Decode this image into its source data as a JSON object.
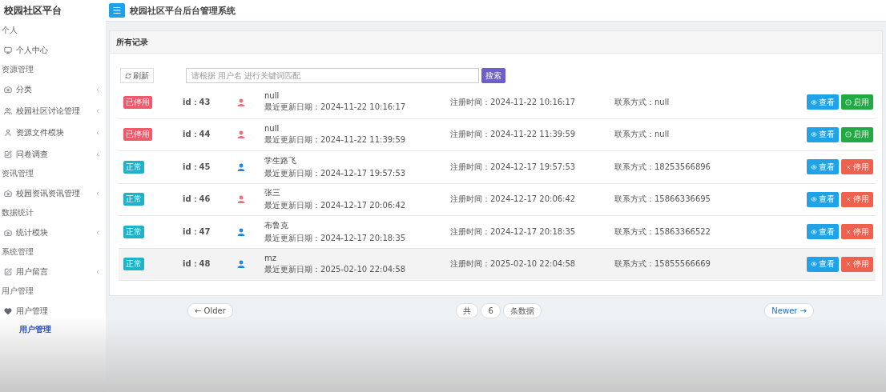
{
  "brand": "校园社区平台",
  "header": {
    "title": "校园社区平台后台管理系统"
  },
  "sidebar": [
    {
      "section": "个人",
      "items": [
        {
          "label": "个人中心",
          "caret": false
        }
      ]
    },
    {
      "section": "资源管理",
      "items": [
        {
          "label": "分类",
          "caret": true
        },
        {
          "label": "校园社区讨论管理",
          "caret": true
        },
        {
          "label": "资源文件模块",
          "caret": true
        },
        {
          "label": "问卷调查",
          "caret": true
        }
      ]
    },
    {
      "section": "资讯管理",
      "items": [
        {
          "label": "校园资讯资讯管理",
          "caret": true
        }
      ]
    },
    {
      "section": "数据统计",
      "items": [
        {
          "label": "统计模块",
          "caret": true
        }
      ]
    },
    {
      "section": "系统管理",
      "items": [
        {
          "label": "用户留言",
          "caret": true
        }
      ]
    },
    {
      "section": "用户管理",
      "items": [
        {
          "label": "用户管理",
          "caret": false,
          "children": [
            {
              "label": "用户管理",
              "selected": true
            }
          ]
        }
      ]
    }
  ],
  "panel": {
    "title": "所有记录",
    "refresh": "刷新",
    "search": {
      "placeholder": "请根据 用户名 进行关键词匹配"
    },
    "search_button": "搜索"
  },
  "rows": [
    {
      "status": {
        "label": "已停用",
        "kind": "disabled"
      },
      "id": "id：43",
      "color": "#e8707f",
      "name": "null",
      "updated": "最近更新日期：2024-11-22 10:16:17",
      "registered": "注册时间：2024-11-22 10:16:17",
      "contact": "联系方式：null",
      "view": "查看",
      "action": {
        "label": "启用",
        "kind": "enable"
      },
      "selected": false
    },
    {
      "status": {
        "label": "已停用",
        "kind": "disabled"
      },
      "id": "id：44",
      "color": "#e8707f",
      "name": "null",
      "updated": "最近更新日期：2024-11-22 11:39:59",
      "registered": "注册时间：2024-11-22 11:39:59",
      "contact": "联系方式：null",
      "view": "查看",
      "action": {
        "label": "启用",
        "kind": "enable"
      },
      "selected": false
    },
    {
      "status": {
        "label": "正常",
        "kind": "normal"
      },
      "id": "id：45",
      "color": "#1e88e5",
      "name": "学生路飞",
      "updated": "最近更新日期：2024-12-17 19:57:53",
      "registered": "注册时间：2024-12-17 19:57:53",
      "contact": "联系方式：18253566896",
      "view": "查看",
      "action": {
        "label": "停用",
        "kind": "disable"
      },
      "selected": false
    },
    {
      "status": {
        "label": "正常",
        "kind": "normal"
      },
      "id": "id：46",
      "color": "#e8707f",
      "name": "张三",
      "updated": "最近更新日期：2024-12-17 20:06:42",
      "registered": "注册时间：2024-12-17 20:06:42",
      "contact": "联系方式：15866336695",
      "view": "查看",
      "action": {
        "label": "停用",
        "kind": "disable"
      },
      "selected": false
    },
    {
      "status": {
        "label": "正常",
        "kind": "normal"
      },
      "id": "id：47",
      "color": "#1e88e5",
      "name": "布鲁克",
      "updated": "最近更新日期：2024-12-17 20:18:35",
      "registered": "注册时间：2024-12-17 20:18:35",
      "contact": "联系方式：15863366522",
      "view": "查看",
      "action": {
        "label": "停用",
        "kind": "disable"
      },
      "selected": false
    },
    {
      "status": {
        "label": "正常",
        "kind": "normal"
      },
      "id": "id：48",
      "color": "#1e88e5",
      "name": "mz",
      "updated": "最近更新日期：2025-02-10 22:04:58",
      "registered": "注册时间：2025-02-10 22:04:58",
      "contact": "联系方式：15855566669",
      "view": "查看",
      "action": {
        "label": "停用",
        "kind": "disable"
      },
      "selected": true
    }
  ],
  "pager": {
    "older": "← Older",
    "total_prefix": "共",
    "total": "6",
    "total_suffix": "条数据",
    "newer": "Newer →"
  }
}
